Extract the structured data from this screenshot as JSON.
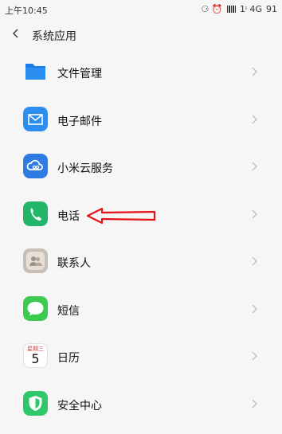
{
  "status_bar": {
    "time": "上午10:45",
    "indicators": "⚆ ⏰",
    "signal_text": "1ᵎ 4G",
    "battery": "91"
  },
  "header": {
    "title": "系统应用"
  },
  "apps": [
    {
      "label": "文件管理",
      "icon": "folder-icon"
    },
    {
      "label": "电子邮件",
      "icon": "mail-icon"
    },
    {
      "label": "小米云服务",
      "icon": "cloud-icon"
    },
    {
      "label": "电话",
      "icon": "phone-icon"
    },
    {
      "label": "联系人",
      "icon": "contacts-icon"
    },
    {
      "label": "短信",
      "icon": "message-icon"
    },
    {
      "label": "日历",
      "icon": "calendar-icon",
      "calendar_weekday": "星期三",
      "calendar_day": "5"
    },
    {
      "label": "安全中心",
      "icon": "security-shield-icon"
    }
  ],
  "annotation": {
    "arrow_color": "#e3151a"
  }
}
